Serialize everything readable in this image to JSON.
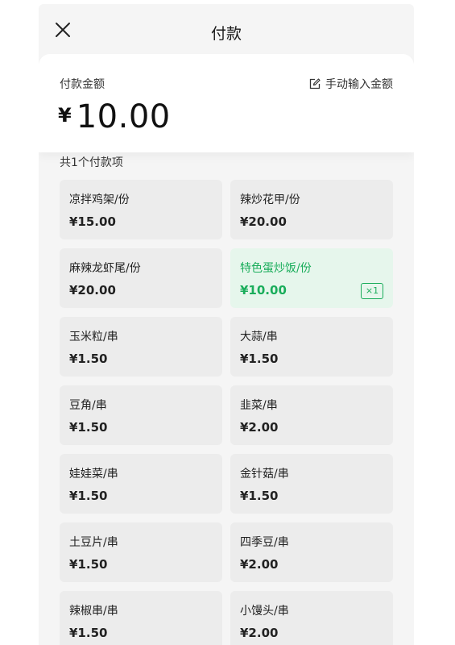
{
  "header": {
    "title": "付款",
    "close_icon": "close-icon"
  },
  "payment": {
    "label": "付款金额",
    "currency": "¥",
    "amount": "10.00",
    "manual_entry": {
      "label": "手动输入金额",
      "icon": "edit-icon"
    }
  },
  "items_summary": "共1个付款项",
  "items": [
    {
      "name": "凉拌鸡架/份",
      "price": "¥15.00",
      "selected": false
    },
    {
      "name": "辣炒花甲/份",
      "price": "¥20.00",
      "selected": false
    },
    {
      "name": "麻辣龙虾尾/份",
      "price": "¥20.00",
      "selected": false
    },
    {
      "name": "特色蛋炒饭/份",
      "price": "¥10.00",
      "selected": true,
      "quantity": "×1"
    },
    {
      "name": "玉米粒/串",
      "price": "¥1.50",
      "selected": false
    },
    {
      "name": "大蒜/串",
      "price": "¥1.50",
      "selected": false
    },
    {
      "name": "豆角/串",
      "price": "¥1.50",
      "selected": false
    },
    {
      "name": "韭菜/串",
      "price": "¥2.00",
      "selected": false
    },
    {
      "name": "娃娃菜/串",
      "price": "¥1.50",
      "selected": false
    },
    {
      "name": "金针菇/串",
      "price": "¥1.50",
      "selected": false
    },
    {
      "name": "土豆片/串",
      "price": "¥1.50",
      "selected": false
    },
    {
      "name": "四季豆/串",
      "price": "¥2.00",
      "selected": false
    },
    {
      "name": "辣椒串/串",
      "price": "¥1.50",
      "selected": false
    },
    {
      "name": "小馒头/串",
      "price": "¥2.00",
      "selected": false
    }
  ],
  "colors": {
    "accent": "#1aad5b",
    "selected_bg": "#e6f6ec",
    "tile_bg": "#ececec"
  }
}
